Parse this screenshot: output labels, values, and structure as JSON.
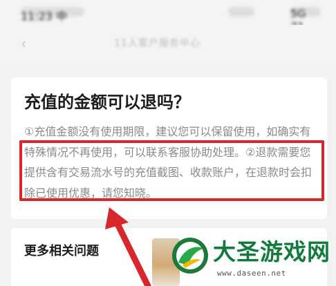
{
  "status_bar": {
    "left_text": "11:23 中",
    "right_text": "5G 71"
  },
  "header": {
    "title": "11人客户服务中心"
  },
  "faq": {
    "question": "充值的金额可以退吗？",
    "answer": "①充值金额没有使用期限，建议您可以保留使用，如确实有特殊情况不再使用，可以联系客服协助处理。②退款需要您提供含有交易流水号的充值截图、收款账户，在退款时会扣除已使用优惠，请您知晓。"
  },
  "related": {
    "title": "更多相关问题"
  },
  "watermark": {
    "name": "大圣游戏网",
    "url": "www.daseen.net"
  },
  "colors": {
    "highlight": "#d8262d",
    "watermark_green": "#117a3c",
    "answer_text": "#8a8a8a"
  },
  "icons": {
    "back": "back-arrow-icon",
    "pointer": "red-arrow-icon",
    "logo": "daseen-logo-icon"
  }
}
